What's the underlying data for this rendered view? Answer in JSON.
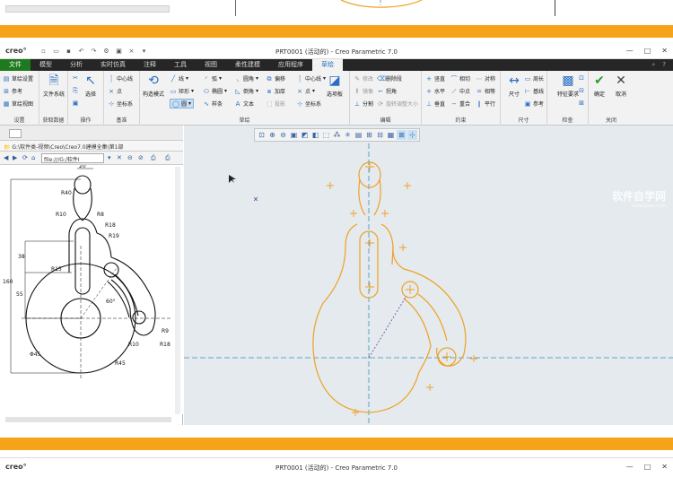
{
  "app": {
    "logo": "creo°",
    "window_title": "PRT0001 (活动的) - Creo Parametric 7.0",
    "min": "—",
    "max": "□",
    "close": "✕"
  },
  "menu": {
    "tabs": [
      "文件",
      "模型",
      "分析",
      "实时仿真",
      "注释",
      "工具",
      "视图",
      "柔性建模",
      "应用程序",
      "草绘"
    ],
    "help": "?"
  },
  "ribbon": {
    "setup": {
      "label": "设置",
      "items": [
        "草绘设置",
        "参考",
        "草绘视图"
      ]
    },
    "get_data": {
      "label": "获取数据",
      "file_system": "文件系统"
    },
    "operations": {
      "label": "操作",
      "select": "选择"
    },
    "datum": {
      "label": "基准",
      "items": [
        "中心线",
        "点",
        "坐标系"
      ]
    },
    "sketch": {
      "label": "草绘",
      "construction": "构造模式",
      "col1": [
        "线",
        "矩形",
        "圆"
      ],
      "col2": [
        "弧",
        "椭圆",
        "样条"
      ],
      "col3": [
        "圆角",
        "倒角",
        "文本"
      ],
      "col4": [
        "偏移",
        "加厚",
        "投影"
      ],
      "col5": [
        "中心线",
        "点",
        "坐标系"
      ],
      "palette": "选项板"
    },
    "editing": {
      "label": "编辑",
      "col1": [
        "修改",
        "镜像",
        "分割"
      ],
      "col2": [
        "删除段",
        "拐角",
        "旋转调整大小"
      ]
    },
    "constraints": {
      "label": "约束",
      "col1": [
        "竖直",
        "水平",
        "垂直"
      ],
      "col2": [
        "相切",
        "中点",
        "重合"
      ],
      "col3": [
        "对称",
        "相等",
        "平行"
      ]
    },
    "dimension": {
      "label": "尺寸",
      "big": "尺寸",
      "items": [
        "周长",
        "基线",
        "参考"
      ]
    },
    "inspect": {
      "label": "检查",
      "big": "特征要求"
    },
    "close": {
      "label": "关闭",
      "ok": "确定",
      "cancel": "取消"
    }
  },
  "browser": {
    "path": "G:\\软件类-视频\\Creo\\Creo7.0建模全集\\第1部",
    "url": "file:///G:/软件I"
  },
  "drawing_dims": {
    "d20": "20",
    "r40": "R40",
    "r10a": "R10",
    "r8": "R8",
    "r18": "R18",
    "r19": "R19",
    "r15": "R15",
    "d38": "38",
    "d55": "55",
    "d160": "160",
    "a60": "60°",
    "r9": "R9",
    "r10b": "R10",
    "r18b": "R18",
    "r45": "R45",
    "phi45": "Φ45"
  },
  "watermark": {
    "brand": "软件自学网",
    "url": "www.rjzxw.com"
  }
}
